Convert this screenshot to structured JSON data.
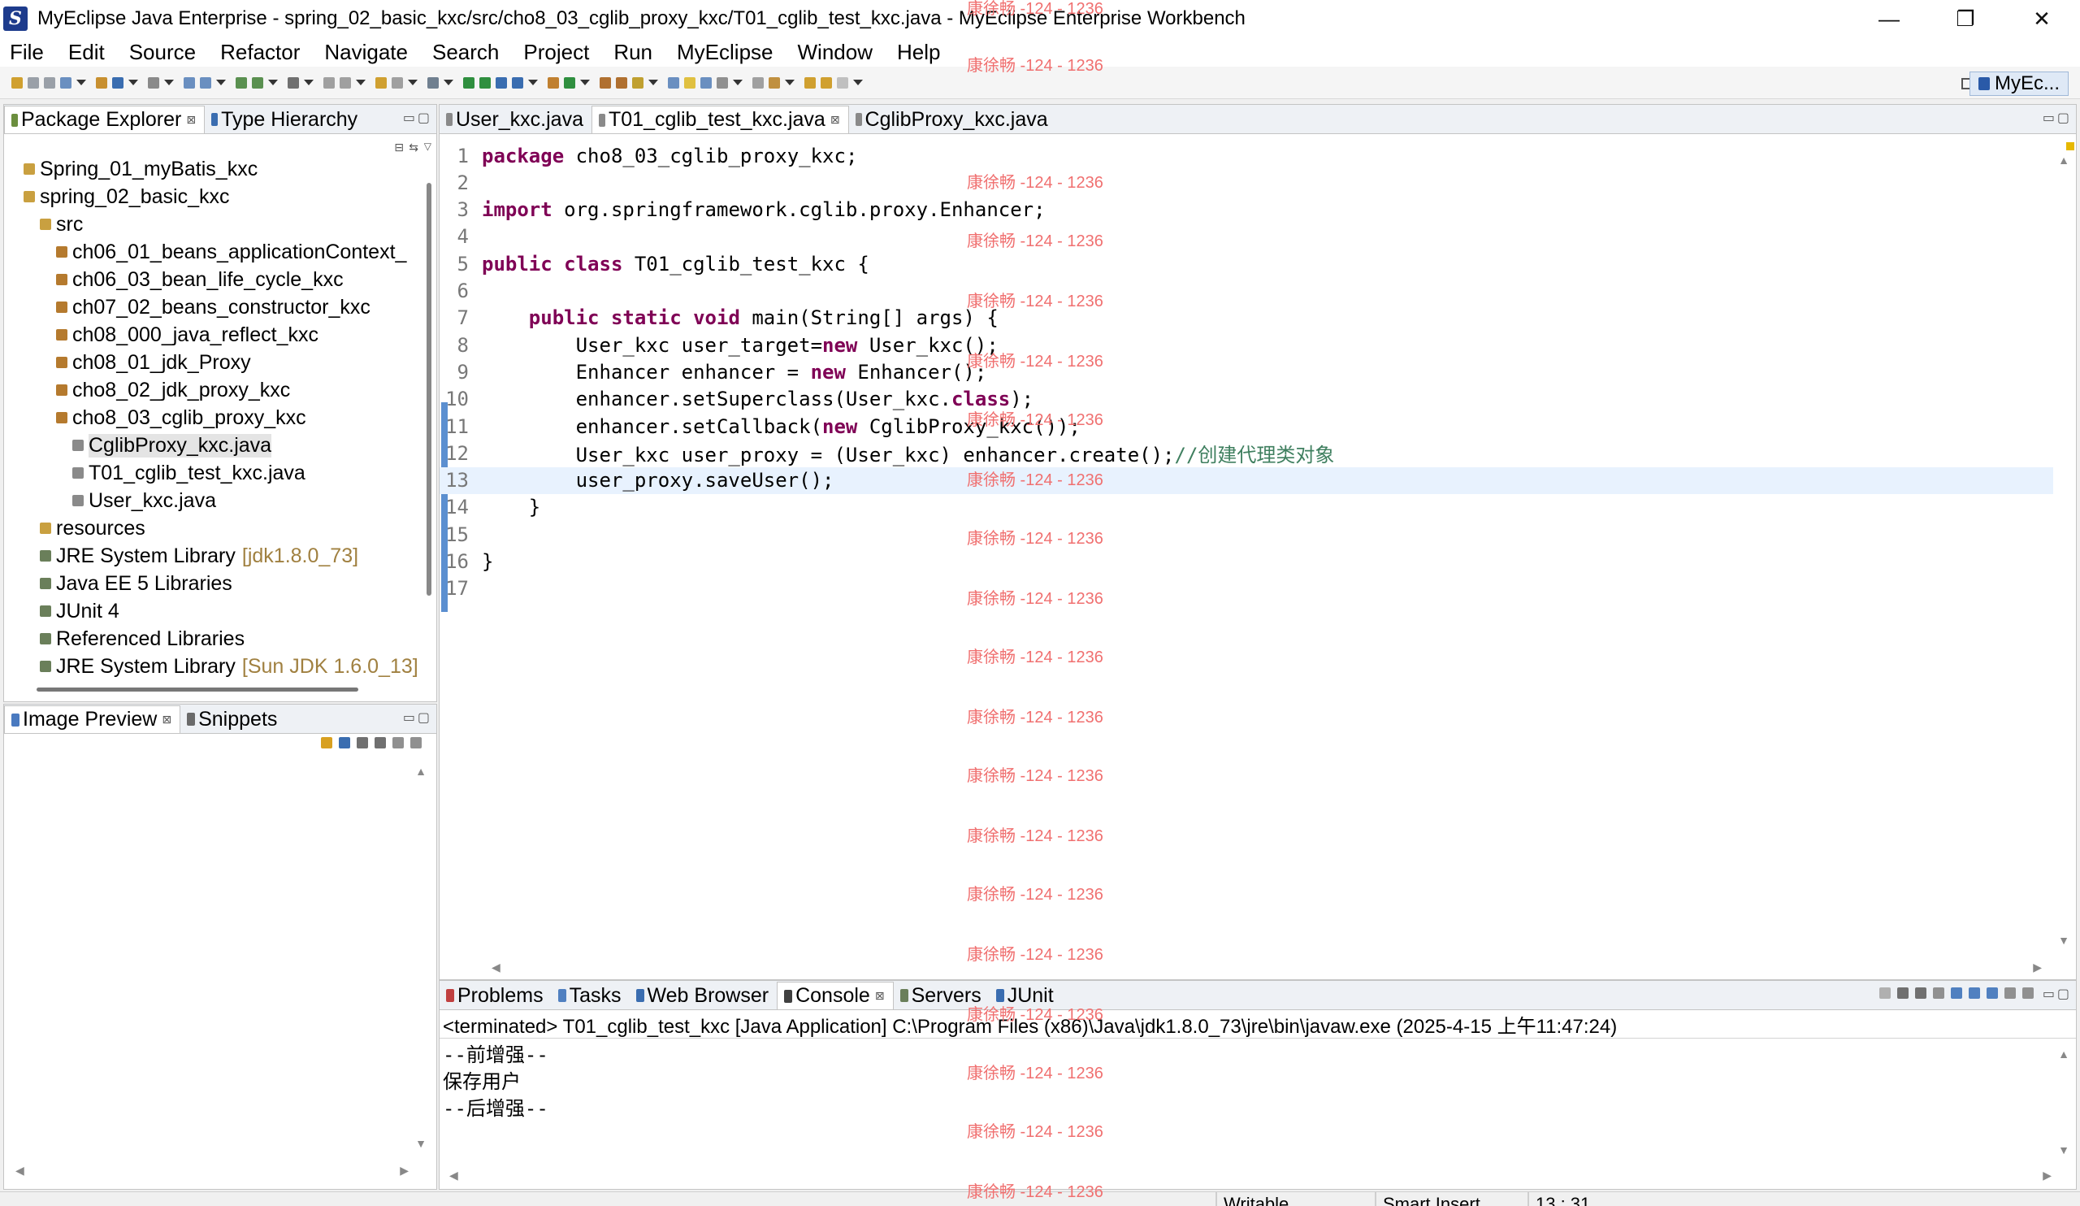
{
  "window": {
    "title": "MyEclipse Java Enterprise - spring_02_basic_kxc/src/cho8_03_cglib_proxy_kxc/T01_cglib_test_kxc.java - MyEclipse Enterprise Workbench",
    "logo_text": "S"
  },
  "window_controls": {
    "minimize": "—",
    "maximize": "❐",
    "close": "✕"
  },
  "menu": [
    "File",
    "Edit",
    "Source",
    "Refactor",
    "Navigate",
    "Search",
    "Project",
    "Run",
    "MyEclipse",
    "Window",
    "Help"
  ],
  "perspective": {
    "label": "MyEc..."
  },
  "package_explorer": {
    "tabs": [
      "Package Explorer",
      "Type Hierarchy"
    ],
    "tree": [
      {
        "label": "Spring_01_myBatis_kxc",
        "extra": "",
        "depth": 0,
        "icon": "project-icon"
      },
      {
        "label": "spring_02_basic_kxc",
        "extra": "",
        "depth": 0,
        "icon": "project-icon"
      },
      {
        "label": "src",
        "extra": "",
        "depth": 1,
        "icon": "source-folder-icon"
      },
      {
        "label": "ch06_01_beans_applicationContext_",
        "extra": "",
        "depth": 2,
        "icon": "package-icon"
      },
      {
        "label": "ch06_03_bean_life_cycle_kxc",
        "extra": "",
        "depth": 2,
        "icon": "package-icon"
      },
      {
        "label": "ch07_02_beans_constructor_kxc",
        "extra": "",
        "depth": 2,
        "icon": "package-icon"
      },
      {
        "label": "ch08_000_java_reflect_kxc",
        "extra": "",
        "depth": 2,
        "icon": "package-icon"
      },
      {
        "label": "ch08_01_jdk_Proxy",
        "extra": "",
        "depth": 2,
        "icon": "package-icon"
      },
      {
        "label": "cho8_02_jdk_proxy_kxc",
        "extra": "",
        "depth": 2,
        "icon": "package-icon"
      },
      {
        "label": "cho8_03_cglib_proxy_kxc",
        "extra": "",
        "depth": 2,
        "icon": "package-icon"
      },
      {
        "label": "CglibProxy_kxc.java",
        "extra": "",
        "depth": 3,
        "icon": "java-file-icon",
        "selected": true
      },
      {
        "label": "T01_cglib_test_kxc.java",
        "extra": "",
        "depth": 3,
        "icon": "java-file-icon"
      },
      {
        "label": "User_kxc.java",
        "extra": "",
        "depth": 3,
        "icon": "java-file-icon"
      },
      {
        "label": "resources",
        "extra": "",
        "depth": 1,
        "icon": "folder-icon"
      },
      {
        "label": "JRE System Library",
        "extra": "[jdk1.8.0_73]",
        "depth": 1,
        "icon": "library-icon"
      },
      {
        "label": "Java EE 5 Libraries",
        "extra": "",
        "depth": 1,
        "icon": "library-icon"
      },
      {
        "label": "JUnit 4",
        "extra": "",
        "depth": 1,
        "icon": "library-icon"
      },
      {
        "label": "Referenced Libraries",
        "extra": "",
        "depth": 1,
        "icon": "library-icon"
      },
      {
        "label": "JRE System Library",
        "extra": "[Sun JDK 1.6.0_13]",
        "depth": 1,
        "icon": "library-icon"
      }
    ]
  },
  "image_preview": {
    "tabs": [
      "Image Preview",
      "Snippets"
    ]
  },
  "editor": {
    "tabs": [
      "User_kxc.java",
      "T01_cglib_test_kxc.java",
      "CglibProxy_kxc.java"
    ],
    "active_tab": 1,
    "current_line": 13,
    "lines": [
      {
        "n": "1",
        "parts": [
          {
            "t": "package",
            "k": "kw"
          },
          {
            "t": " cho8_03_cglib_proxy_kxc;",
            "k": ""
          }
        ]
      },
      {
        "n": "2",
        "parts": []
      },
      {
        "n": "3",
        "parts": [
          {
            "t": "import",
            "k": "kw"
          },
          {
            "t": " org.springframework.cglib.proxy.Enhancer;",
            "k": ""
          }
        ]
      },
      {
        "n": "4",
        "parts": []
      },
      {
        "n": "5",
        "parts": [
          {
            "t": "public",
            "k": "kw"
          },
          {
            "t": " ",
            "k": ""
          },
          {
            "t": "class",
            "k": "kw"
          },
          {
            "t": " T01_cglib_test_kxc {",
            "k": ""
          }
        ]
      },
      {
        "n": "6",
        "parts": []
      },
      {
        "n": "7",
        "parts": [
          {
            "t": "    ",
            "k": ""
          },
          {
            "t": "public",
            "k": "kw"
          },
          {
            "t": " ",
            "k": ""
          },
          {
            "t": "static",
            "k": "kw"
          },
          {
            "t": " ",
            "k": ""
          },
          {
            "t": "void",
            "k": "kw"
          },
          {
            "t": " main(String[] args) {",
            "k": ""
          }
        ]
      },
      {
        "n": "8",
        "parts": [
          {
            "t": "        User_kxc user_target=",
            "k": ""
          },
          {
            "t": "new",
            "k": "kw"
          },
          {
            "t": " User_kxc();",
            "k": ""
          }
        ]
      },
      {
        "n": "9",
        "parts": [
          {
            "t": "        Enhancer enhancer = ",
            "k": ""
          },
          {
            "t": "new",
            "k": "kw"
          },
          {
            "t": " Enhancer();",
            "k": ""
          }
        ]
      },
      {
        "n": "10",
        "parts": [
          {
            "t": "        enhancer.setSuperclass(User_kxc.",
            "k": ""
          },
          {
            "t": "class",
            "k": "kw"
          },
          {
            "t": ");",
            "k": ""
          }
        ]
      },
      {
        "n": "11",
        "parts": [
          {
            "t": "        enhancer.setCallback(",
            "k": ""
          },
          {
            "t": "new",
            "k": "kw"
          },
          {
            "t": " CglibProxy_kxc());",
            "k": ""
          }
        ]
      },
      {
        "n": "12",
        "parts": [
          {
            "t": "        User_kxc user_proxy = (User_kxc) enhancer.create();",
            "k": ""
          },
          {
            "t": "//创建代理类对象",
            "k": "cm"
          }
        ]
      },
      {
        "n": "13",
        "parts": [
          {
            "t": "        user_proxy.saveUser();",
            "k": ""
          }
        ]
      },
      {
        "n": "14",
        "parts": [
          {
            "t": "    }",
            "k": ""
          }
        ]
      },
      {
        "n": "15",
        "parts": []
      },
      {
        "n": "16",
        "parts": [
          {
            "t": "}",
            "k": ""
          }
        ]
      },
      {
        "n": "17",
        "parts": []
      }
    ]
  },
  "console": {
    "tabs": [
      "Problems",
      "Tasks",
      "Web Browser",
      "Console",
      "Servers",
      "JUnit"
    ],
    "active_tab": 3,
    "header": "<terminated> T01_cglib_test_kxc [Java Application] C:\\Program Files (x86)\\Java\\jdk1.8.0_73\\jre\\bin\\javaw.exe (2025-4-15 上午11:47:24)",
    "output": [
      "--前增强--",
      "保存用户",
      "--后增强--"
    ]
  },
  "statusbar": {
    "writable": "Writable",
    "insert_mode": "Smart Insert",
    "position": "13 : 31"
  },
  "watermark": {
    "text": "康徐畅 -124 - 1236"
  },
  "colors": {
    "keyword": "#7f0055",
    "comment": "#3f7f5f",
    "current_line": "#e8f2fe",
    "watermark": "#f07070"
  }
}
